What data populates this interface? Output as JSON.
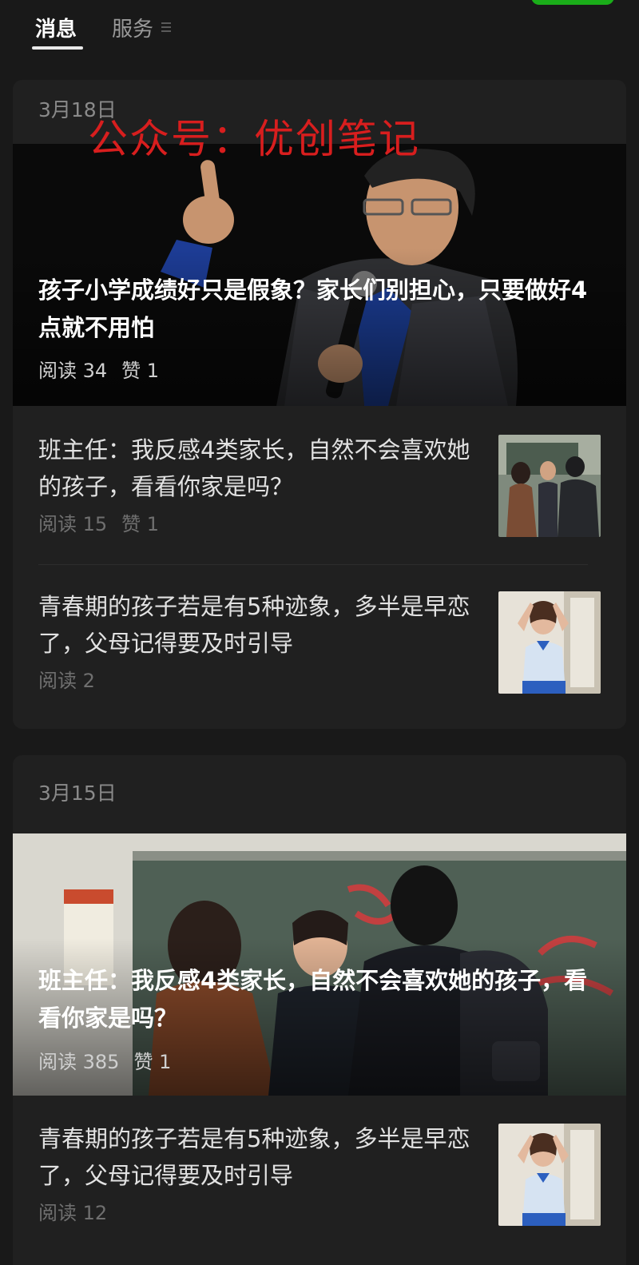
{
  "tabs": {
    "messages_label": "消息",
    "services_label": "服务"
  },
  "watermark_text": "公众号：优创笔记",
  "groups": [
    {
      "date": "3月18日",
      "hero": {
        "title": "孩子小学成绩好只是假象？家长们别担心，只要做好4点就不用怕",
        "reads": "阅读 34",
        "likes": "赞 1"
      },
      "items": [
        {
          "title": "班主任：我反感4类家长，自然不会喜欢她的孩子，看看你家是吗？",
          "reads": "阅读 15",
          "likes": "赞 1"
        },
        {
          "title": "青春期的孩子若是有5种迹象，多半是早恋了，父母记得要及时引导",
          "reads": "阅读 2",
          "likes": ""
        }
      ]
    },
    {
      "date": "3月15日",
      "hero": {
        "title": "班主任：我反感4类家长，自然不会喜欢她的孩子，看看你家是吗？",
        "reads": "阅读 385",
        "likes": "赞 1"
      },
      "items": [
        {
          "title": "青春期的孩子若是有5种迹象，多半是早恋了，父母记得要及时引导",
          "reads": "阅读 12",
          "likes": ""
        }
      ]
    }
  ],
  "colors": {
    "background": "#191919",
    "card": "#202020",
    "accent_green": "#1aad19",
    "watermark_red": "#d81e1e"
  }
}
